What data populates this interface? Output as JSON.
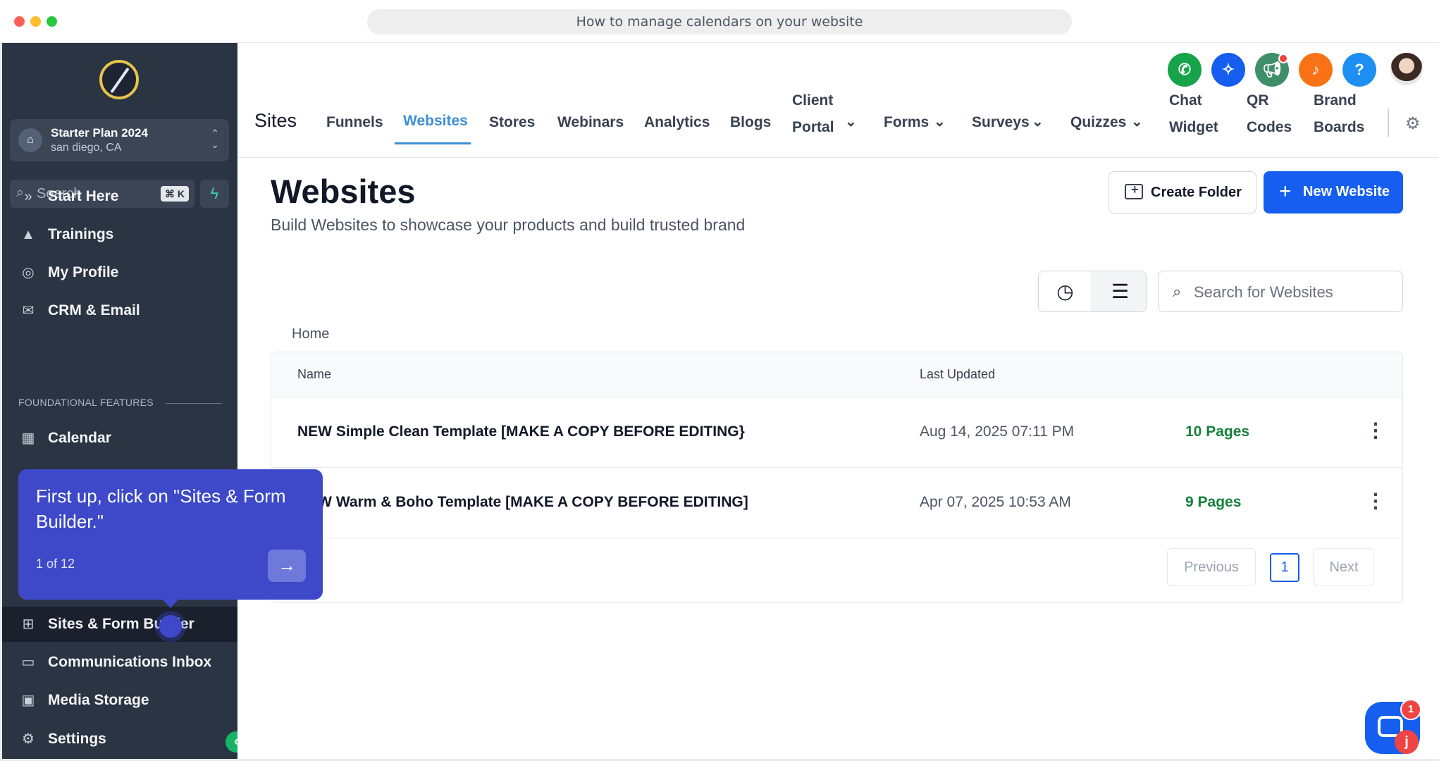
{
  "window": {
    "title": "How to manage calendars on your website"
  },
  "sidebar": {
    "plan_name": "Starter Plan 2024",
    "plan_location": "san diego, CA",
    "search_placeholder": "Search",
    "search_shortcut": "⌘ K",
    "nav_top": [
      {
        "label": "Start Here",
        "icon": "double-chevron-icon"
      },
      {
        "label": "Trainings",
        "icon": "graduation-cap-icon"
      },
      {
        "label": "My Profile",
        "icon": "user-circle-icon"
      },
      {
        "label": "CRM & Email",
        "icon": "envelope-open-icon"
      }
    ],
    "section_label": "FOUNDATIONAL FEATURES",
    "nav_features": [
      {
        "label": "Calendar",
        "icon": "calendar-icon"
      },
      {
        "label": "Sites & Form Builder",
        "icon": "sitemap-icon"
      },
      {
        "label": "Communications Inbox",
        "icon": "inbox-icon"
      },
      {
        "label": "Media Storage",
        "icon": "image-icon"
      }
    ],
    "settings_label": "Settings"
  },
  "header": {
    "section_title": "Sites",
    "tabs": [
      {
        "label": "Funnels"
      },
      {
        "label": "Websites"
      },
      {
        "label": "Stores"
      },
      {
        "label": "Webinars"
      },
      {
        "label": "Analytics"
      },
      {
        "label": "Blogs"
      },
      {
        "label": "Client\nPortal"
      },
      {
        "label": "Forms"
      },
      {
        "label": "Surveys"
      },
      {
        "label": "Quizzes"
      },
      {
        "label": "Chat\nWidget"
      },
      {
        "label": "QR\nCodes"
      },
      {
        "label": "Brand\nBoards"
      }
    ],
    "selected_tab": "Websites",
    "top_icons": [
      {
        "name": "phone-icon",
        "color": "#16a34a"
      },
      {
        "name": "sparkle-icon",
        "color": "#155eef"
      },
      {
        "name": "megaphone-icon",
        "color": "#3f8f6a"
      },
      {
        "name": "bell-icon",
        "color": "#f97316"
      },
      {
        "name": "help-icon",
        "color": "#1d8ff2"
      }
    ]
  },
  "page": {
    "title": "Websites",
    "subtitle": "Build Websites to showcase your products and build trusted brand",
    "create_folder_label": "Create Folder",
    "new_website_label": "New Website",
    "search_placeholder": "Search for Websites",
    "breadcrumb": "Home",
    "table": {
      "columns": [
        "Name",
        "Last Updated"
      ],
      "rows": [
        {
          "name": "NEW Simple Clean Template [MAKE A COPY BEFORE EDITING}",
          "updated": "Aug 14, 2025 07:11 PM",
          "pages": "10 Pages"
        },
        {
          "name": "NEW Warm & Boho Template [MAKE A COPY BEFORE EDITING]",
          "updated": "Apr 07, 2025 10:53 AM",
          "pages": "9 Pages"
        }
      ]
    },
    "pagination": {
      "previous": "Previous",
      "current": "1",
      "next": "Next"
    }
  },
  "tooltip": {
    "message": "First up, click on \"Sites & Form Builder.\"",
    "counter": "1 of 12"
  },
  "chat_widget": {
    "badge": "1",
    "letter": "j"
  }
}
